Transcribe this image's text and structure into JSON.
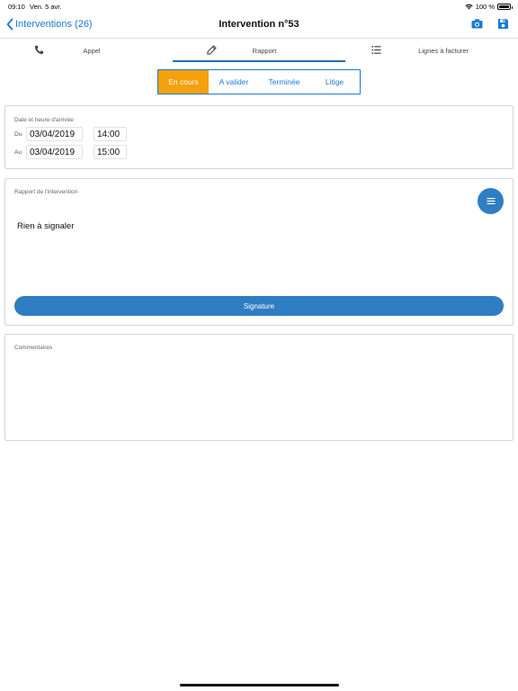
{
  "status_bar": {
    "time": "09:10",
    "date": "Ven. 5 avr.",
    "battery": "100 %",
    "battery_level": 1.0
  },
  "nav": {
    "back_label": "Interventions (26)",
    "title": "Intervention n°53",
    "icons": [
      "camera-icon",
      "save-icon"
    ],
    "accent_color": "#1a7ad8"
  },
  "tabs": [
    {
      "label": "Appel",
      "icon": "phone-icon"
    },
    {
      "label": "Rapport",
      "icon": "pencil-icon",
      "active": true
    },
    {
      "label": "Lignes à facturer",
      "icon": "list-icon"
    }
  ],
  "status_segments": {
    "options": [
      "En cours",
      "A valider",
      "Terminée",
      "Litige"
    ],
    "selected": "En cours",
    "selected_color": "#f5a10e"
  },
  "arrival": {
    "title": "Date et heure d'arrivée",
    "from_label": "Du",
    "from_date": "03/04/2019",
    "from_time": "14:00",
    "to_label": "Au",
    "to_date": "03/04/2019",
    "to_time": "15:00"
  },
  "report": {
    "title": "Rapport de l'intervention",
    "text": "Rien à signaler",
    "menu_icon": "menu-icon",
    "signature_label": "Signature",
    "button_color": "#2f7dc2"
  },
  "comments": {
    "title": "Commentaires",
    "text": ""
  }
}
